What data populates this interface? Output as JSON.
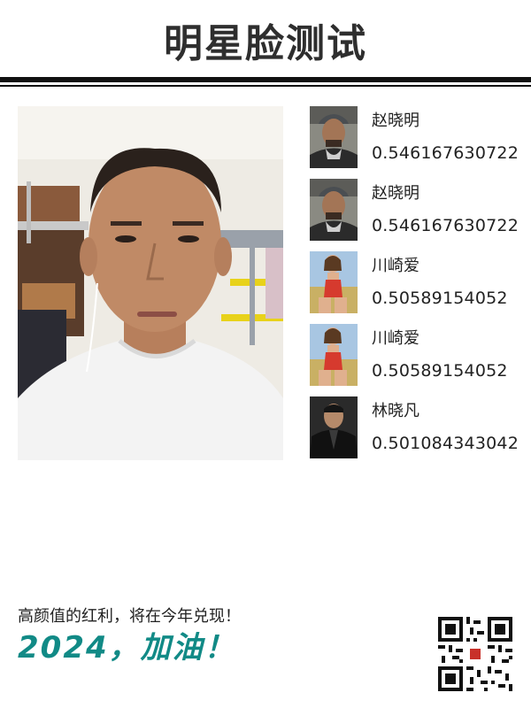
{
  "header": {
    "title": "明星脸测试"
  },
  "photo": {
    "alt": "user-photo"
  },
  "matches": [
    {
      "name": "赵晓明",
      "score": "0.546167630722",
      "thumb": "man-with-cap"
    },
    {
      "name": "赵晓明",
      "score": "0.546167630722",
      "thumb": "man-with-cap"
    },
    {
      "name": "川崎爱",
      "score": "0.50589154052",
      "thumb": "woman-red-swimsuit"
    },
    {
      "name": "川崎爱",
      "score": "0.50589154052",
      "thumb": "woman-red-swimsuit"
    },
    {
      "name": "林晓凡",
      "score": "0.501084343042",
      "thumb": "man-dark-jacket"
    }
  ],
  "footer": {
    "slogan": "高颜值的红利，将在今年兑现！",
    "cheer": "2024，加油！",
    "qr_icon": "qr-code-icon"
  },
  "colors": {
    "accent": "#118a86",
    "rule": "#111111",
    "title": "#2e2e2e"
  }
}
